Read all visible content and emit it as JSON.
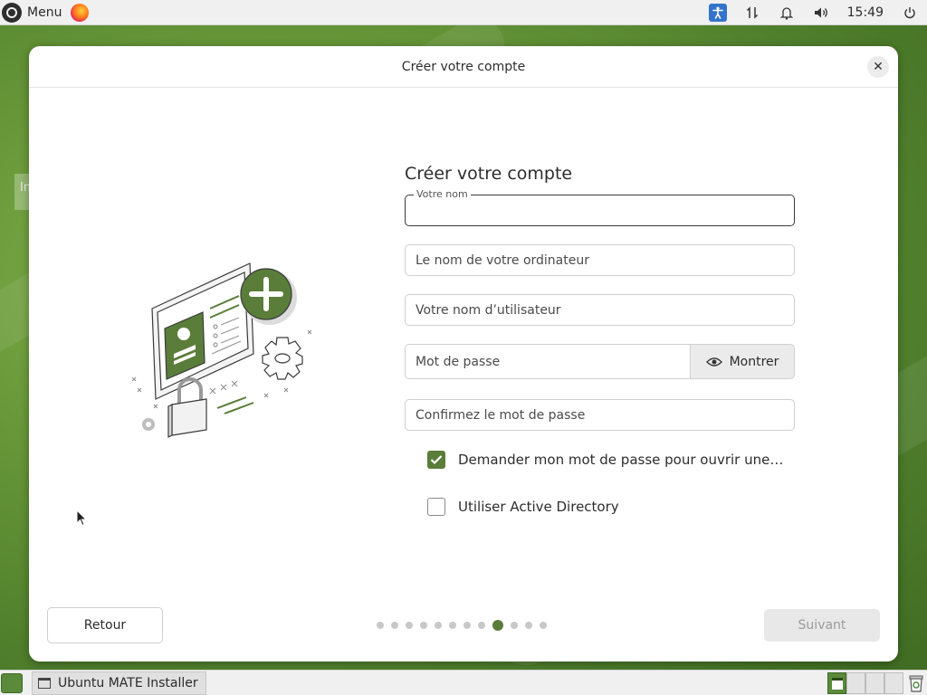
{
  "top_panel": {
    "menu_label": "Menu",
    "clock": "15:49",
    "icons": [
      "ubuntu-logo-icon",
      "firefox-icon",
      "accessibility-icon",
      "network-icon",
      "notification-bell-icon",
      "volume-icon",
      "power-icon"
    ]
  },
  "desktop": {
    "peek_text": "In"
  },
  "window": {
    "title": "Créer votre compte",
    "close_icon": "close-icon"
  },
  "form": {
    "heading": "Créer votre compte",
    "name_label": "Votre nom",
    "name_value": "",
    "computer_placeholder": "Le nom de votre ordinateur",
    "username_placeholder": "Votre nom d’utilisateur",
    "password_placeholder": "Mot de passe",
    "show_label": "Montrer",
    "confirm_placeholder": "Confirmez le mot de passe",
    "ask_password_label": "Demander mon mot de passe pour ouvrir une s…",
    "ask_password_checked": true,
    "active_directory_label": "Utiliser Active Directory",
    "active_directory_checked": false
  },
  "footer": {
    "back_label": "Retour",
    "next_label": "Suivant",
    "steps_total": 12,
    "current_step": 9
  },
  "bottom_panel": {
    "task_label": "Ubuntu MATE Installer",
    "workspaces": 4,
    "active_workspace": 1
  },
  "colors": {
    "accent": "#5a7d3a",
    "a11y_blue": "#3373cc",
    "disabled_text": "#9a9a9a"
  }
}
